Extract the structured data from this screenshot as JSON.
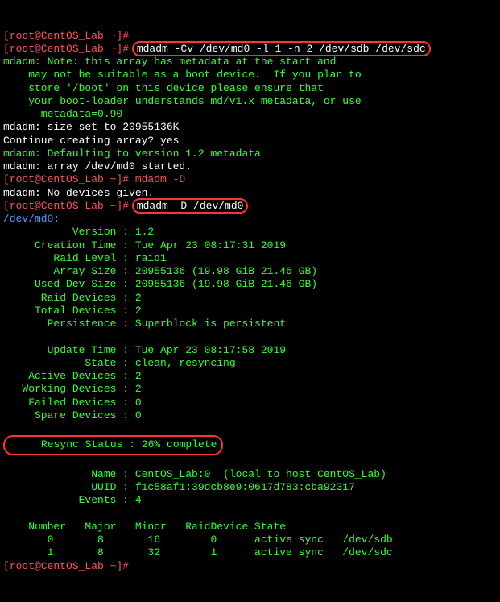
{
  "lines": {
    "l0": "[root@CentOS_Lab ~]#",
    "l1_prompt": "[root@CentOS_Lab ~]# ",
    "l1_cmd": "mdadm -Cv /dev/md0 -l 1 -n 2 /dev/sdb /dev/sdc",
    "l2": "mdadm: Note: this array has metadata at the start and",
    "l3": "    may not be suitable as a boot device.  If you plan to",
    "l4": "    store '/boot' on this device please ensure that",
    "l5": "    your boot-loader understands md/v1.x metadata, or use",
    "l6": "    --metadata=0.90",
    "l7": "mdadm: size set to 20955136K",
    "l8": "Continue creating array? yes",
    "l9": "mdadm: Defaulting to version 1.2 metadata",
    "l10": "mdadm: array /dev/md0 started.",
    "l11": "[root@CentOS_Lab ~]# mdadm -D",
    "l12": "mdadm: No devices given.",
    "l13_prompt": "[root@CentOS_Lab ~]# ",
    "l13_cmd": "mdadm -D /dev/md0",
    "l14": "/dev/md0:",
    "l15": "           Version : 1.2",
    "l16": "     Creation Time : Tue Apr 23 08:17:31 2019",
    "l17": "        Raid Level : raid1",
    "l18": "        Array Size : 20955136 (19.98 GiB 21.46 GB)",
    "l19": "     Used Dev Size : 20955136 (19.98 GiB 21.46 GB)",
    "l20": "      Raid Devices : 2",
    "l21": "     Total Devices : 2",
    "l22": "       Persistence : Superblock is persistent",
    "l23": "",
    "l24": "       Update Time : Tue Apr 23 08:17:58 2019",
    "l25": "             State : clean, resyncing",
    "l26": "    Active Devices : 2",
    "l27": "   Working Devices : 2",
    "l28": "    Failed Devices : 0",
    "l29": "     Spare Devices : 0",
    "l30": "",
    "l31": "     Resync Status : 26% complete",
    "l32": "",
    "l33": "              Name : CentOS_Lab:0  (local to host CentOS_Lab)",
    "l34": "              UUID : f1c58af1:39dcb8e9:0617d783:cba92317",
    "l35": "            Events : 4",
    "l36": "",
    "l37": "    Number   Major   Minor   RaidDevice State",
    "l38": "       0       8       16        0      active sync   /dev/sdb",
    "l39": "       1       8       32        1      active sync   /dev/sdc",
    "l40": "[root@CentOS_Lab ~]#"
  }
}
